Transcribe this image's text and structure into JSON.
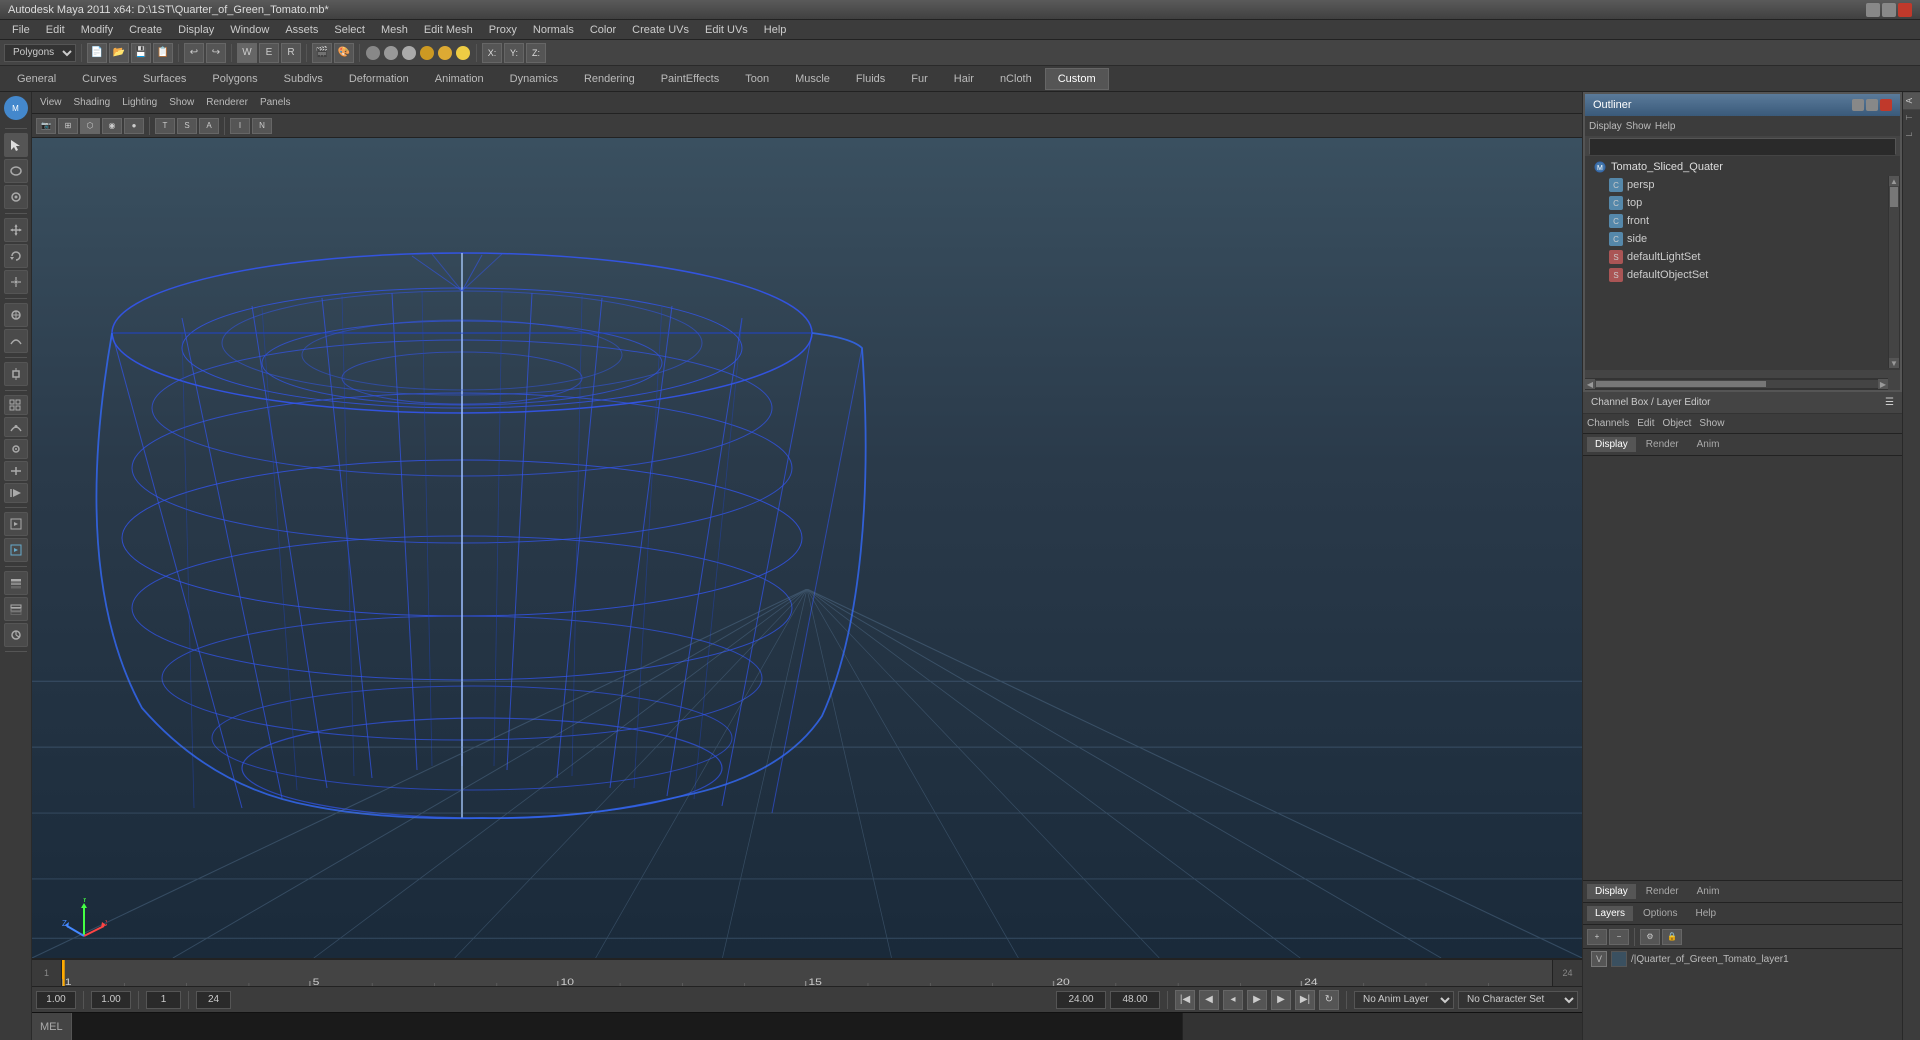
{
  "app": {
    "title": "Autodesk Maya 2011 x64: D:\\1ST\\Quarter_of_Green_Tomato.mb*",
    "window_controls": [
      "minimize",
      "maximize",
      "close"
    ]
  },
  "menu": {
    "items": [
      "File",
      "Edit",
      "Modify",
      "Create",
      "Display",
      "Window",
      "Assets",
      "Select",
      "Mesh",
      "Edit Mesh",
      "Proxy",
      "Normals",
      "Color",
      "Create UVs",
      "Edit UVs",
      "Help"
    ]
  },
  "toolbar1": {
    "mode_label": "Polygons"
  },
  "module_tabs": {
    "items": [
      "General",
      "Curves",
      "Surfaces",
      "Polygons",
      "Subdivs",
      "Deformation",
      "Animation",
      "Dynamics",
      "Rendering",
      "PaintEffects",
      "Toon",
      "Muscle",
      "Fluids",
      "Fur",
      "Hair",
      "nCloth",
      "Custom"
    ],
    "active": "Custom"
  },
  "viewport": {
    "menu_items": [
      "View",
      "Shading",
      "Lighting",
      "Show",
      "Renderer",
      "Panels"
    ],
    "lighting_label": "Lighting"
  },
  "outliner": {
    "title": "Outliner",
    "menu_items": [
      "Display",
      "Show",
      "Help"
    ],
    "items": [
      {
        "name": "Tomato_Sliced_Quater",
        "type": "mesh",
        "indent": 1
      },
      {
        "name": "persp",
        "type": "camera",
        "indent": 2
      },
      {
        "name": "top",
        "type": "camera",
        "indent": 2
      },
      {
        "name": "front",
        "type": "camera",
        "indent": 2
      },
      {
        "name": "side",
        "type": "camera",
        "indent": 2
      },
      {
        "name": "defaultLightSet",
        "type": "set",
        "indent": 2
      },
      {
        "name": "defaultObjectSet",
        "type": "set",
        "indent": 2
      }
    ]
  },
  "channel_box": {
    "title": "Channel Box / Layer Editor",
    "tabs": [
      "Display",
      "Render",
      "Anim"
    ],
    "active_tab": "Display",
    "sub_tabs": [
      "Layers",
      "Options",
      "Help"
    ]
  },
  "layer_editor": {
    "tabs": [
      "Display",
      "Render",
      "Anim"
    ],
    "sub_tabs": [
      "Layers",
      "Options",
      "Help"
    ],
    "layers": [
      {
        "visible": "V",
        "name": "/|Quarter_of_Green_Tomato_layer1"
      }
    ]
  },
  "timeline": {
    "start": "1",
    "end": "24",
    "current": "1",
    "range_start": "1.00",
    "range_end": "24.00",
    "anim_end": "48.00",
    "ticks": [
      "1",
      "",
      "",
      "",
      "5",
      "",
      "",
      "",
      "",
      "10",
      "",
      "",
      "",
      "",
      "15",
      "",
      "",
      "",
      "",
      "20",
      "",
      "",
      "",
      "24"
    ]
  },
  "playback": {
    "current_time": "1.00",
    "frame_step": "1.00",
    "current_frame": "1",
    "end_frame": "24",
    "buttons": [
      "|◀",
      "◀◀",
      "◀",
      "▶",
      "▶▶",
      "▶|",
      "◀▶"
    ],
    "anim_end": "24.00",
    "anim_end2": "48.00",
    "anim_preset": "No Anim Layer",
    "char_preset": "No Character Set"
  },
  "cmd": {
    "label": "MEL",
    "placeholder": ""
  },
  "axis": {
    "x_color": "#ff4444",
    "y_color": "#44ff44",
    "z_color": "#4444ff"
  }
}
